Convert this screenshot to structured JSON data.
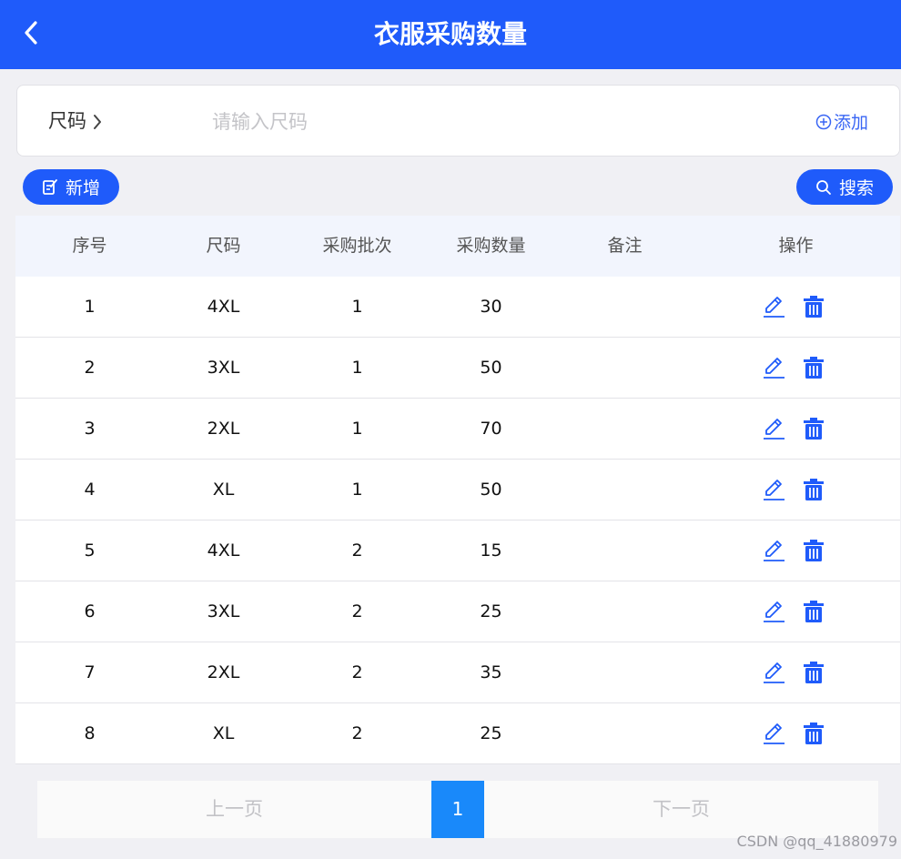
{
  "header": {
    "title": "衣服采购数量",
    "back_icon": "chevron-left-icon"
  },
  "form": {
    "label": "尺码",
    "placeholder": "请输入尺码",
    "value": "",
    "add_label": "添加"
  },
  "toolbar": {
    "new_label": "新增",
    "search_label": "搜索"
  },
  "table": {
    "columns": [
      "序号",
      "尺码",
      "采购批次",
      "采购数量",
      "备注",
      "操作"
    ],
    "rows": [
      {
        "index": "1",
        "size": "4XL",
        "batch": "1",
        "qty": "30",
        "note": ""
      },
      {
        "index": "2",
        "size": "3XL",
        "batch": "1",
        "qty": "50",
        "note": ""
      },
      {
        "index": "3",
        "size": "2XL",
        "batch": "1",
        "qty": "70",
        "note": ""
      },
      {
        "index": "4",
        "size": "XL",
        "batch": "1",
        "qty": "50",
        "note": ""
      },
      {
        "index": "5",
        "size": "4XL",
        "batch": "2",
        "qty": "15",
        "note": ""
      },
      {
        "index": "6",
        "size": "3XL",
        "batch": "2",
        "qty": "25",
        "note": ""
      },
      {
        "index": "7",
        "size": "2XL",
        "batch": "2",
        "qty": "35",
        "note": ""
      },
      {
        "index": "8",
        "size": "XL",
        "batch": "2",
        "qty": "25",
        "note": ""
      }
    ]
  },
  "pagination": {
    "prev_label": "上一页",
    "current": "1",
    "next_label": "下一页"
  },
  "watermark": "CSDN @qq_41880979",
  "colors": {
    "primary": "#1f5bfa",
    "page_active": "#1989fa",
    "background": "#f0f0f4"
  }
}
